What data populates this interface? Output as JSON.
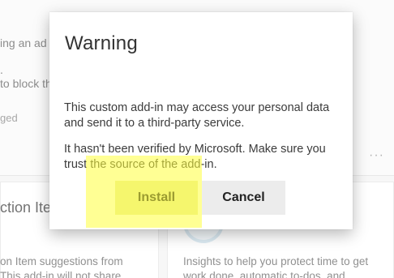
{
  "background": {
    "line1": "ing an ad",
    "line2": ".",
    "line3": "to block th",
    "line4": "ged",
    "more": "···",
    "card_left_title": "ction Item",
    "card_left_body_1": "on Item suggestions from",
    "card_left_body_2": "This add-in will not share",
    "card_right_body_1": "Insights to help you protect time to get",
    "card_right_body_2": "work done, automatic to-dos, and"
  },
  "dialog": {
    "title": "Warning",
    "close": "⤢",
    "message1": "This custom add-in may access your personal data and send it to a third-party service.",
    "message2": "It hasn't been verified by Microsoft. Make sure you trust the source of the add-in.",
    "install_label": "Install",
    "cancel_label": "Cancel"
  },
  "colors": {
    "highlight": "#ffff3c",
    "install_button": "#e9eca9",
    "cancel_button": "#ececec"
  }
}
